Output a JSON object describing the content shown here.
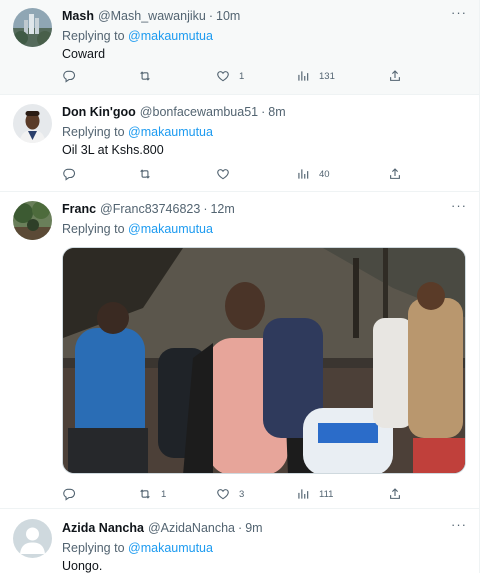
{
  "tweets": [
    {
      "name": "Mash",
      "handle": "@Mash_wawanjiku",
      "time": "10m",
      "replying_prefix": "Replying to ",
      "replying_to": "@makaumutua",
      "text": "Coward",
      "replies": "",
      "retweets": "",
      "likes": "1",
      "views": "131"
    },
    {
      "name": "Don Kin'goo",
      "handle": "@bonfacewambua51",
      "time": "8m",
      "replying_prefix": "Replying to ",
      "replying_to": "@makaumutua",
      "text": "Oil 3L at Kshs.800",
      "replies": "",
      "retweets": "",
      "likes": "",
      "views": "40"
    },
    {
      "name": "Franc",
      "handle": "@Franc83746823",
      "time": "12m",
      "replying_prefix": "Replying to ",
      "replying_to": "@makaumutua",
      "text": "",
      "replies": "",
      "retweets": "1",
      "likes": "3",
      "views": "111"
    },
    {
      "name": "Azida Nancha",
      "handle": "@AzidaNancha",
      "time": "9m",
      "replying_prefix": "Replying to ",
      "replying_to": "@makaumutua",
      "text": "Uongo.",
      "replies": "",
      "retweets": "",
      "likes": "",
      "views": ""
    }
  ],
  "separator": "·",
  "more_glyph": "···",
  "colors": {
    "accent": "#1d9bf0",
    "secondary_text": "#536471",
    "border": "#eff3f4"
  },
  "icons": [
    "reply-icon",
    "retweet-icon",
    "like-icon",
    "views-icon",
    "share-icon",
    "more-icon"
  ]
}
